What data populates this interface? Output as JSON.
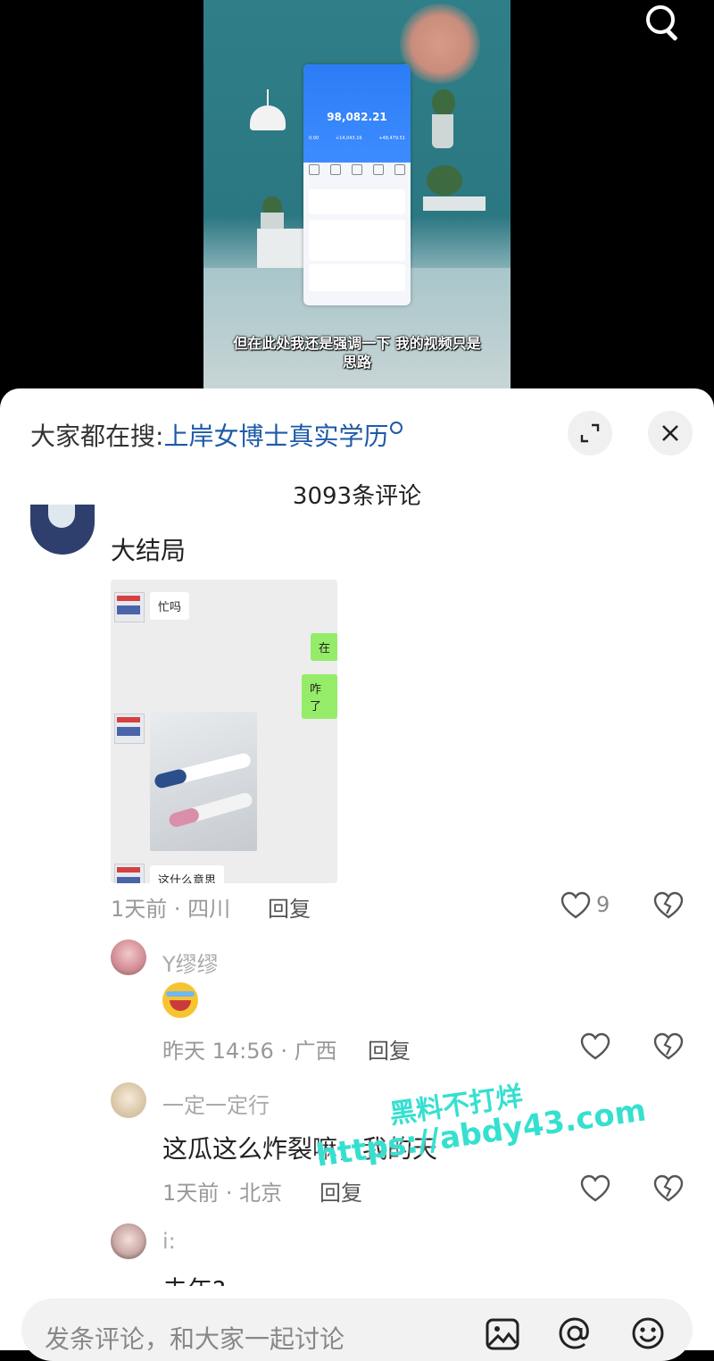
{
  "video": {
    "subtitle_line1": "但在此处我还是强调一下 我的视频只是",
    "subtitle_line2": "思路",
    "phone_amount": "98,082.21",
    "phone_stat_1": "0.00",
    "phone_stat_2": "+14,043.16",
    "phone_stat_3": "+48,479.51"
  },
  "search": {
    "prefix": "大家都在搜:",
    "keyword": "上岸女博士真实学历"
  },
  "comments_header": {
    "count_label": "3093条评论"
  },
  "comments": [
    {
      "name": "大结局",
      "chat_image": {
        "msg1": "忙吗",
        "msg2": "在",
        "msg3": "咋了",
        "msg4": "这什么意思"
      },
      "meta": "1天前 · 四川",
      "reply_label": "回复",
      "likes": "9"
    }
  ],
  "replies": [
    {
      "name": "Y缪缪",
      "meta": "昨天 14:56 · 广西",
      "reply_label": "回复"
    },
    {
      "name": "一定一定行",
      "text": "这瓜这么炸裂嘛，我的天",
      "meta": "1天前 · 北京",
      "reply_label": "回复"
    },
    {
      "name": "i:",
      "text": "去年?"
    }
  ],
  "watermark": {
    "line1": "黑料不打烊",
    "line2": "https://abdy43.com"
  },
  "input": {
    "placeholder": "发条评论，和大家一起讨论"
  },
  "colors": {
    "link": "#1e5aa8",
    "watermark": "#35e0d0",
    "wechat_green": "#95ec69"
  },
  "icons": [
    "search-icon",
    "expand-icon",
    "close-icon",
    "heart-icon",
    "broken-heart-icon",
    "image-icon",
    "at-icon",
    "emoji-icon"
  ]
}
